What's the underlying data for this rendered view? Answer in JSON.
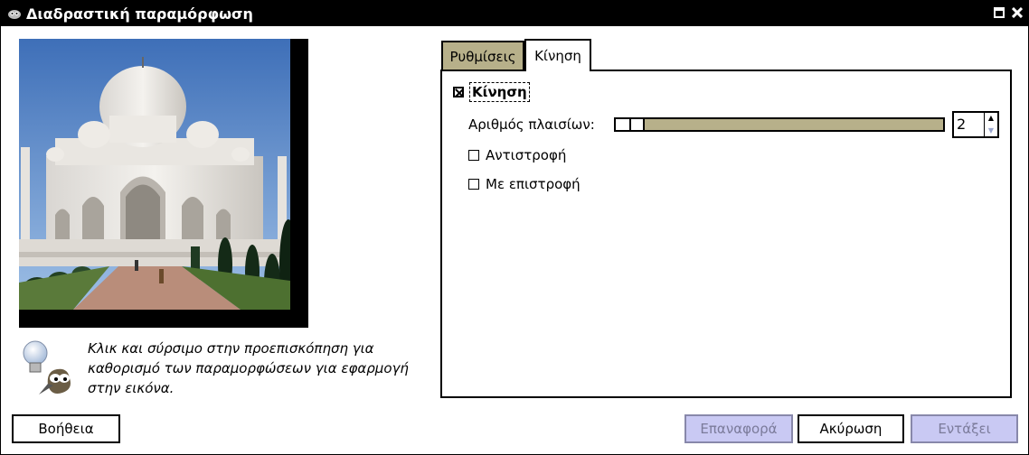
{
  "window": {
    "title": "Διαδραστική παραμόρφωση"
  },
  "hint": {
    "text_line1": "Κλικ και σύρσιμο στην προεπισκόπηση για",
    "text_line2": "καθορισμό των παραμορφώσεων για εφαρμογή",
    "text_line3": "στην εικόνα."
  },
  "tabs": [
    {
      "label": "Ρυθμίσεις",
      "active": false
    },
    {
      "label": "Κίνηση",
      "active": true
    }
  ],
  "motion": {
    "enable_label": "Κίνηση",
    "enable_checked": true,
    "frames_label": "Αριθμός πλαισίων:",
    "frames_value": "2",
    "reverse_label": "Αντιστροφή",
    "reverse_checked": false,
    "pingpong_label": "Με επιστροφή",
    "pingpong_checked": false
  },
  "buttons": {
    "help": "Βοήθεια",
    "reset": "Επαναφορά",
    "cancel": "Ακύρωση",
    "ok": "Εντάξει"
  },
  "colors": {
    "accent": "#b7b08a",
    "disabled_button": "#c9c9f3"
  }
}
